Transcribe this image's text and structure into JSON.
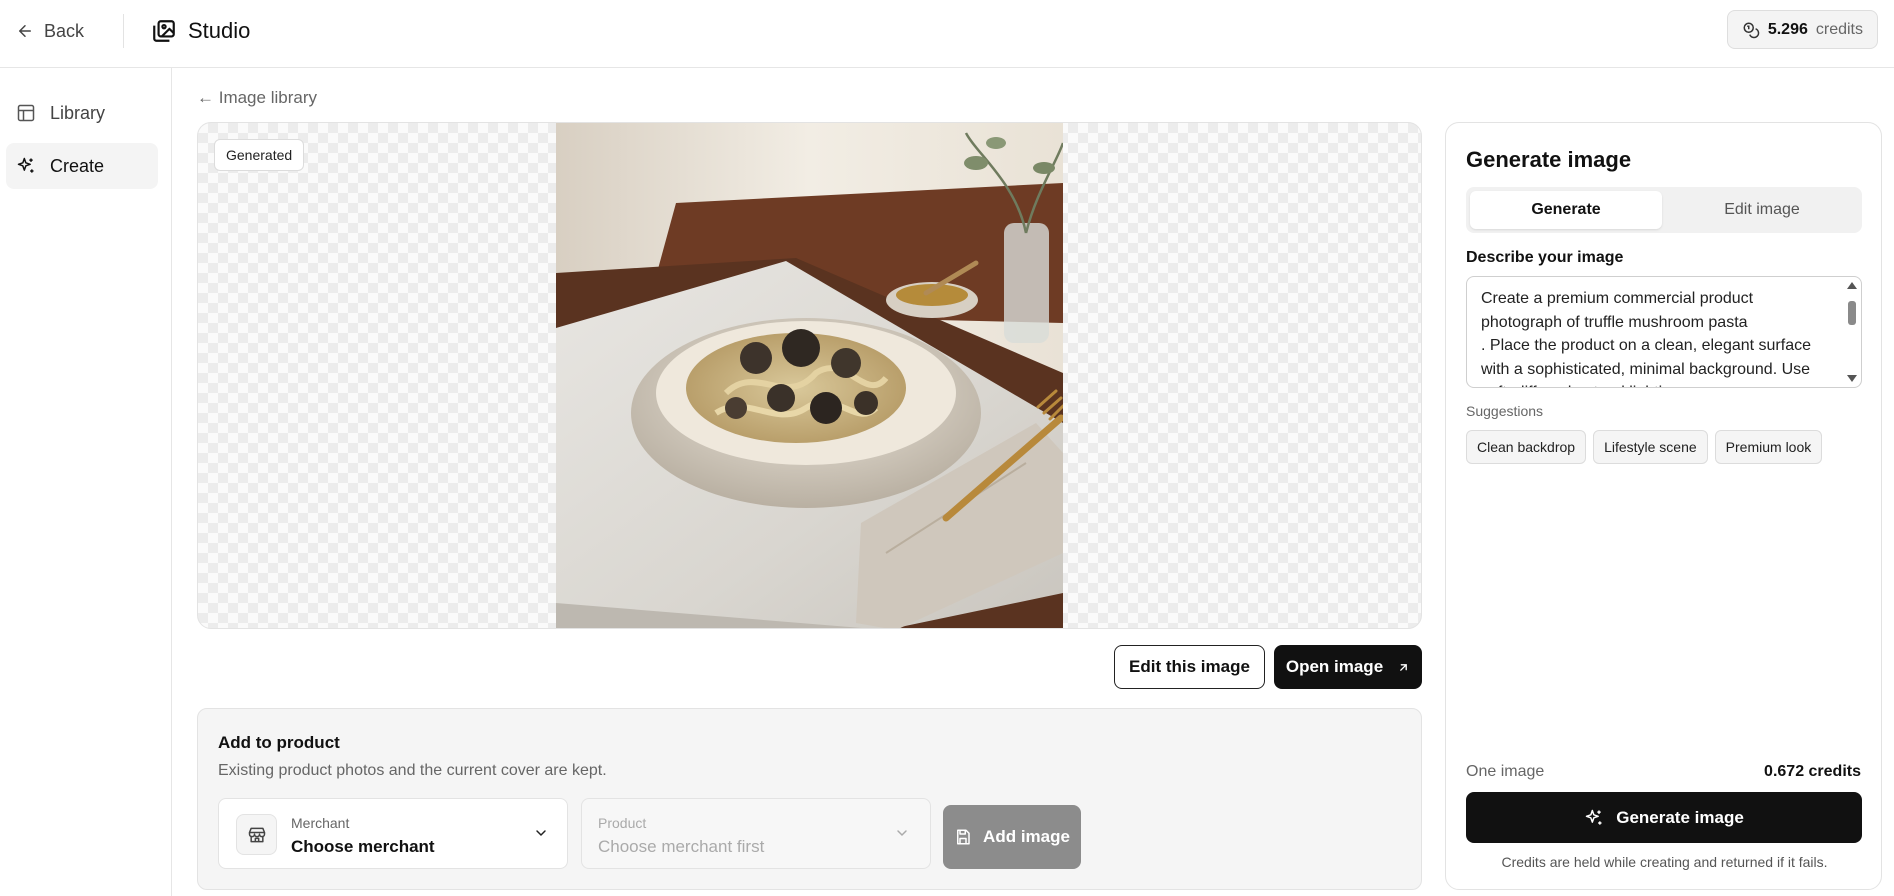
{
  "topbar": {
    "back_label": "Back",
    "brand": "Studio",
    "credits_value": "5.296",
    "credits_unit": "credits"
  },
  "sidebar": {
    "items": [
      {
        "label": "Library",
        "icon": "layout-icon"
      },
      {
        "label": "Create",
        "icon": "sparkle-icon",
        "active": true
      }
    ]
  },
  "breadcrumb": {
    "label": "← Image library"
  },
  "canvas": {
    "badge": "Generated"
  },
  "image_actions": {
    "edit_label": "Edit this image",
    "open_label": "Open image"
  },
  "add_to_product": {
    "title": "Add to product",
    "subtitle": "Existing product photos and the current cover are kept.",
    "merchant": {
      "label": "Merchant",
      "value": "Choose merchant"
    },
    "product": {
      "label": "Product",
      "value": "Choose merchant first"
    },
    "add_label": "Add image"
  },
  "panel": {
    "title": "Generate image",
    "tabs": [
      {
        "label": "Generate",
        "active": true
      },
      {
        "label": "Edit image"
      }
    ],
    "describe_label": "Describe your image",
    "prompt": "Create a premium commercial product photograph of truffle mushroom pasta\n. Place the product on a clean, elegant surface with a sophisticated, minimal background. Use soft, diffused natural lighting.",
    "suggestions_label": "Suggestions",
    "suggestions": [
      "Clean backdrop",
      "Lifestyle scene",
      "Premium look"
    ],
    "one_image_label": "One image",
    "cost": "0.672 credits",
    "generate_label": "Generate image",
    "note": "Credits are held while creating and returned if it fails."
  },
  "colors": {
    "accent": "#111111",
    "disabled": "#8c8c8c",
    "surface": "#f5f5f5"
  }
}
